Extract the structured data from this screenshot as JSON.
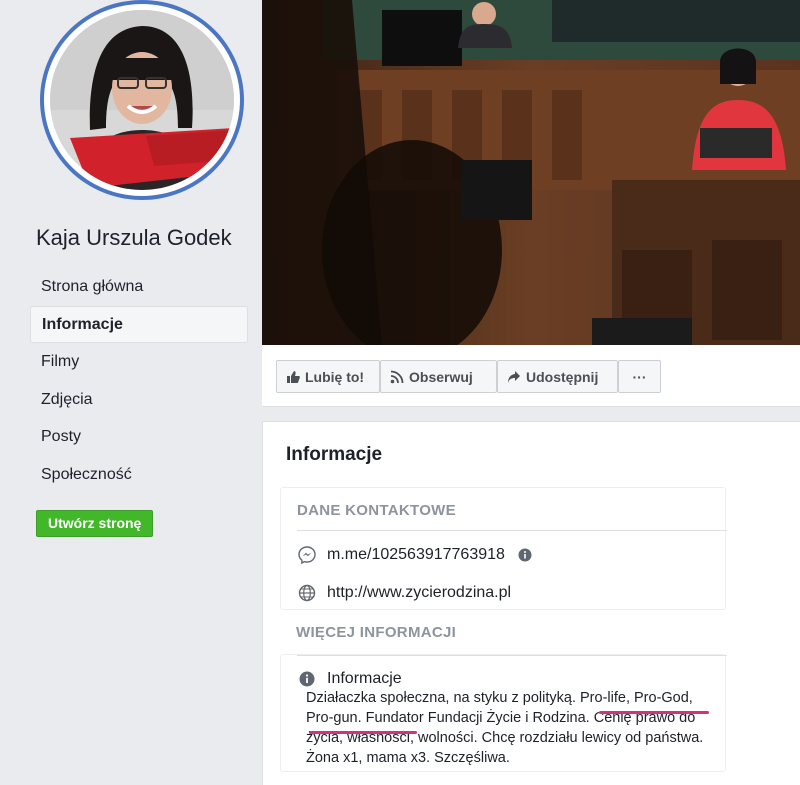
{
  "sidebar": {
    "page_name": "Kaja Urszula Godek",
    "nav": [
      {
        "label": "Strona główna"
      },
      {
        "label": "Informacje"
      },
      {
        "label": "Filmy"
      },
      {
        "label": "Zdjęcia"
      },
      {
        "label": "Posty"
      },
      {
        "label": "Społeczność"
      }
    ],
    "create_page_label": "Utwórz stronę"
  },
  "actions": {
    "like_label": "Lubię to!",
    "follow_label": "Obserwuj",
    "share_label": "Udostępnij",
    "more_label": "···"
  },
  "info": {
    "title": "Informacje",
    "contact_heading": "DANE KONTAKTOWE",
    "messenger_link": "m.me/102563917763918",
    "website": "http://www.zycierodzina.pl",
    "more_heading": "WIĘCEJ INFORMACJI",
    "about_label": "Informacje",
    "about_text": "Działaczka społeczna, na styku z polityką. Pro-life, Pro-God, Pro-gun. Fundator Fundacji Życie i Rodzina. Cenię prawo do życia, własności, wolności. Chcę rozdziału lewicy od państwa. Żona x1, mama x3. Szczęśliwa."
  },
  "colors": {
    "accent_blue": "#4a76c4",
    "create_green": "#42b72a",
    "highlight_pink": "#d6317d"
  }
}
